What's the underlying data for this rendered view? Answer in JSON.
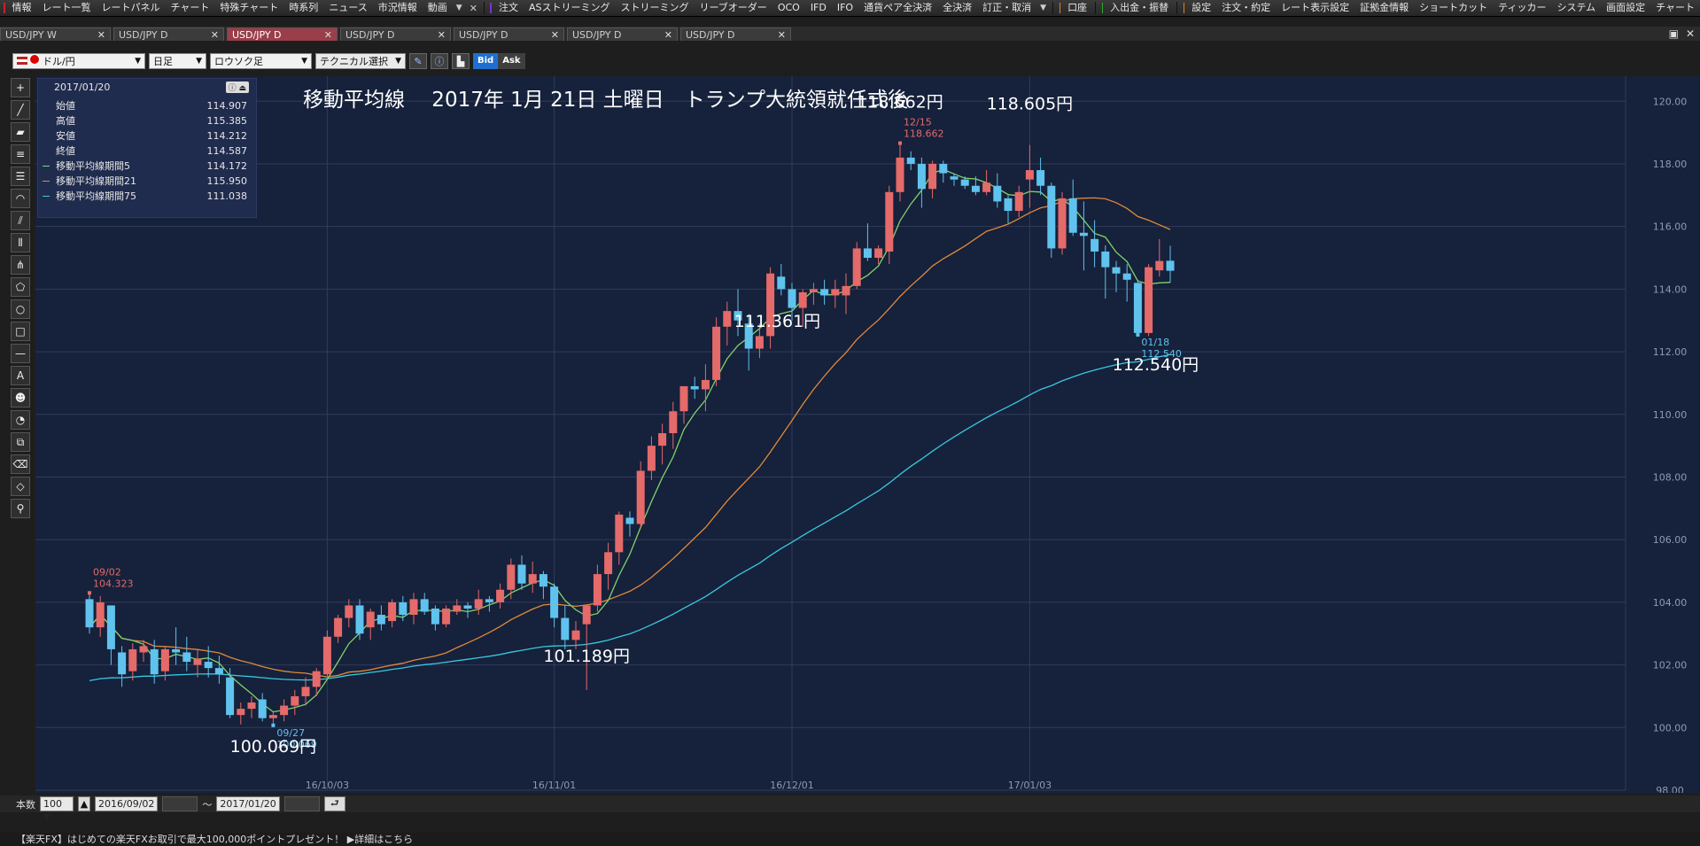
{
  "menubar": {
    "items": [
      {
        "label": "情報",
        "mark": "#cc2222"
      },
      {
        "label": "レート一覧"
      },
      {
        "label": "レートパネル"
      },
      {
        "label": "チャート"
      },
      {
        "label": "特殊チャート"
      },
      {
        "label": "時系列"
      },
      {
        "label": "ニュース"
      },
      {
        "label": "市況情報"
      },
      {
        "label": "動画"
      }
    ],
    "group2": [
      {
        "label": "注文",
        "mark": "#7733cc"
      },
      {
        "label": "ASストリーミング"
      },
      {
        "label": "ストリーミング"
      },
      {
        "label": "リーブオーダー"
      },
      {
        "label": "OCO"
      },
      {
        "label": "IFD"
      },
      {
        "label": "IFO"
      },
      {
        "label": "通貨ペア全決済"
      },
      {
        "label": "全決済"
      },
      {
        "label": "訂正・取消"
      }
    ],
    "group3": [
      {
        "label": "口座",
        "mark": "#e08020"
      }
    ],
    "group4": [
      {
        "label": "入出金・振替",
        "mark": "#33aa33"
      }
    ],
    "group5": [
      {
        "label": "設定",
        "mark": "#e08020"
      },
      {
        "label": "注文・約定"
      },
      {
        "label": "レート表示設定"
      },
      {
        "label": "証拠金情報"
      },
      {
        "label": "ショートカット"
      },
      {
        "label": "ティッカー"
      },
      {
        "label": "システム"
      },
      {
        "label": "画面設定"
      },
      {
        "label": "チャート"
      }
    ]
  },
  "tabs": [
    {
      "label": "USD/JPY W",
      "active": false
    },
    {
      "label": "USD/JPY D",
      "active": false
    },
    {
      "label": "USD/JPY D",
      "active": true
    },
    {
      "label": "USD/JPY D",
      "active": false
    },
    {
      "label": "USD/JPY D",
      "active": false
    },
    {
      "label": "USD/JPY D",
      "active": false
    },
    {
      "label": "USD/JPY D",
      "active": false
    }
  ],
  "toolbar": {
    "pair": "ドル/円",
    "timeframe": "日足",
    "chart_type": "ロウソク足",
    "technical": "テクニカル選択",
    "bid": "Bid",
    "ask": "Ask"
  },
  "databox": {
    "date": "2017/01/20",
    "rows": [
      {
        "label": "始値",
        "value": "114.907"
      },
      {
        "label": "高値",
        "value": "115.385"
      },
      {
        "label": "安値",
        "value": "114.212"
      },
      {
        "label": "終値",
        "value": "114.587"
      },
      {
        "label": "移動平均線期間5",
        "value": "114.172",
        "color": "#7fd36b"
      },
      {
        "label": "移動平均線期間21",
        "value": "115.950",
        "color": "#e0893b"
      },
      {
        "label": "移動平均線期間75",
        "value": "111.038",
        "color": "#38c8e0"
      }
    ]
  },
  "bottombar": {
    "count_label": "本数",
    "count_value": "100",
    "from_date": "2016/09/02",
    "tilde": "〜",
    "to_date": "2017/01/20"
  },
  "adbar": {
    "text": "【楽天FX】はじめての楽天FXお取引で最大100,000ポイントプレゼント！ ▶詳細はこちら"
  },
  "colors": {
    "up": "#e56a6a",
    "down": "#5fc3ee",
    "bg": "#16213b",
    "grid": "#2f3c5b"
  },
  "chart_data": {
    "type": "candlestick",
    "title": "移動平均線　 2017年 1月 21日 土曜日　トランプ大統領就任式後",
    "ylim": [
      98,
      120.8
    ],
    "yticks": [
      "98.00",
      "100.00",
      "102.00",
      "104.00",
      "106.00",
      "108.00",
      "110.00",
      "112.00",
      "114.00",
      "116.00",
      "118.00",
      "120.00"
    ],
    "x_labels": [
      {
        "label": "16/10/03",
        "index": 22
      },
      {
        "label": "16/11/01",
        "index": 43
      },
      {
        "label": "16/12/01",
        "index": 65
      },
      {
        "label": "17/01/03",
        "index": 87
      }
    ],
    "candles": [
      [
        104.1,
        104.3,
        103.0,
        103.2
      ],
      [
        103.2,
        104.2,
        102.9,
        104.0
      ],
      [
        103.9,
        103.9,
        102.0,
        102.5
      ],
      [
        102.4,
        102.6,
        101.3,
        101.7
      ],
      [
        101.8,
        102.7,
        101.5,
        102.5
      ],
      [
        102.4,
        102.8,
        102.1,
        102.6
      ],
      [
        102.5,
        102.8,
        101.4,
        101.7
      ],
      [
        101.8,
        102.6,
        101.5,
        102.5
      ],
      [
        102.5,
        103.2,
        102.0,
        102.4
      ],
      [
        102.4,
        102.9,
        101.8,
        102.1
      ],
      [
        102.0,
        102.5,
        101.6,
        102.2
      ],
      [
        102.1,
        102.6,
        101.6,
        101.9
      ],
      [
        101.9,
        102.3,
        101.4,
        101.7
      ],
      [
        101.6,
        101.9,
        100.3,
        100.4
      ],
      [
        100.4,
        100.8,
        100.1,
        100.6
      ],
      [
        100.6,
        101.0,
        100.3,
        100.8
      ],
      [
        100.9,
        101.1,
        100.2,
        100.3
      ],
      [
        100.3,
        100.5,
        100.07,
        100.4
      ],
      [
        100.4,
        100.9,
        100.2,
        100.7
      ],
      [
        100.7,
        101.2,
        100.4,
        101.0
      ],
      [
        101.0,
        101.6,
        100.7,
        101.3
      ],
      [
        101.3,
        101.9,
        101.0,
        101.8
      ],
      [
        101.7,
        103.1,
        101.6,
        102.9
      ],
      [
        102.9,
        103.6,
        102.7,
        103.5
      ],
      [
        103.5,
        104.1,
        103.2,
        103.9
      ],
      [
        103.9,
        104.1,
        102.8,
        103.0
      ],
      [
        103.2,
        103.8,
        102.8,
        103.7
      ],
      [
        103.6,
        103.9,
        103.1,
        103.3
      ],
      [
        103.4,
        104.1,
        103.2,
        104.0
      ],
      [
        104.0,
        104.2,
        103.4,
        103.6
      ],
      [
        103.6,
        104.3,
        103.3,
        104.1
      ],
      [
        104.1,
        104.3,
        103.6,
        103.7
      ],
      [
        103.8,
        103.9,
        103.1,
        103.3
      ],
      [
        103.3,
        103.9,
        103.2,
        103.8
      ],
      [
        103.7,
        104.1,
        103.6,
        103.9
      ],
      [
        103.9,
        104.0,
        103.5,
        103.8
      ],
      [
        103.8,
        104.4,
        103.6,
        104.1
      ],
      [
        104.1,
        104.2,
        103.7,
        104.0
      ],
      [
        104.0,
        104.6,
        103.8,
        104.4
      ],
      [
        104.4,
        105.4,
        104.1,
        105.2
      ],
      [
        105.2,
        105.5,
        104.4,
        104.6
      ],
      [
        104.6,
        105.3,
        104.3,
        104.9
      ],
      [
        104.9,
        105.0,
        104.1,
        104.5
      ],
      [
        104.5,
        104.6,
        103.2,
        103.5
      ],
      [
        103.5,
        103.9,
        102.5,
        102.8
      ],
      [
        102.8,
        103.4,
        102.5,
        103.1
      ],
      [
        103.3,
        103.9,
        101.2,
        103.9
      ],
      [
        103.9,
        105.2,
        103.7,
        104.9
      ],
      [
        104.9,
        105.9,
        104.4,
        105.6
      ],
      [
        105.6,
        106.9,
        105.2,
        106.8
      ],
      [
        106.7,
        106.9,
        106.1,
        106.5
      ],
      [
        106.5,
        108.5,
        106.4,
        108.2
      ],
      [
        108.2,
        109.3,
        107.9,
        109.0
      ],
      [
        109.0,
        109.7,
        108.4,
        109.4
      ],
      [
        109.4,
        110.4,
        108.9,
        110.1
      ],
      [
        110.1,
        110.9,
        109.7,
        110.9
      ],
      [
        110.9,
        111.2,
        110.5,
        110.8
      ],
      [
        110.8,
        111.6,
        110.1,
        111.1
      ],
      [
        111.1,
        113.1,
        110.9,
        112.8
      ],
      [
        112.8,
        113.6,
        112.2,
        113.3
      ],
      [
        113.3,
        114.0,
        112.5,
        113.0
      ],
      [
        112.9,
        113.2,
        111.4,
        112.1
      ],
      [
        112.1,
        112.9,
        111.8,
        112.5
      ],
      [
        112.5,
        114.7,
        112.1,
        114.5
      ],
      [
        114.4,
        114.8,
        113.8,
        114.0
      ],
      [
        114.0,
        114.2,
        113.0,
        113.4
      ],
      [
        113.4,
        114.0,
        112.8,
        113.9
      ],
      [
        113.9,
        114.2,
        113.5,
        114.0
      ],
      [
        114.0,
        114.3,
        113.5,
        113.8
      ],
      [
        113.8,
        114.3,
        113.4,
        114.0
      ],
      [
        113.8,
        114.5,
        113.2,
        114.1
      ],
      [
        114.1,
        115.5,
        114.0,
        115.3
      ],
      [
        115.3,
        116.1,
        114.9,
        115.0
      ],
      [
        115.0,
        115.4,
        114.8,
        115.3
      ],
      [
        115.2,
        117.3,
        114.8,
        117.1
      ],
      [
        117.1,
        118.662,
        116.8,
        118.2
      ],
      [
        118.2,
        118.4,
        117.8,
        118.0
      ],
      [
        118.0,
        118.2,
        116.6,
        117.2
      ],
      [
        117.2,
        118.1,
        116.9,
        118.0
      ],
      [
        118.0,
        118.1,
        117.4,
        117.7
      ],
      [
        117.6,
        117.7,
        117.3,
        117.5
      ],
      [
        117.5,
        117.6,
        117.2,
        117.3
      ],
      [
        117.3,
        117.6,
        117.0,
        117.1
      ],
      [
        117.1,
        117.8,
        117.0,
        117.4
      ],
      [
        117.3,
        117.7,
        116.6,
        116.8
      ],
      [
        116.9,
        117.0,
        116.1,
        116.5
      ],
      [
        116.5,
        117.3,
        116.3,
        117.1
      ],
      [
        117.5,
        118.605,
        116.6,
        117.8
      ],
      [
        117.8,
        118.2,
        117.0,
        117.3
      ],
      [
        117.3,
        117.4,
        115.0,
        115.3
      ],
      [
        115.3,
        117.1,
        115.1,
        116.9
      ],
      [
        116.9,
        117.5,
        115.7,
        115.8
      ],
      [
        115.8,
        116.8,
        114.6,
        115.7
      ],
      [
        115.6,
        116.2,
        114.7,
        115.2
      ],
      [
        115.2,
        115.4,
        113.7,
        114.7
      ],
      [
        114.7,
        114.9,
        113.9,
        114.5
      ],
      [
        114.5,
        114.8,
        113.6,
        114.3
      ],
      [
        114.2,
        114.3,
        112.54,
        112.6
      ],
      [
        112.6,
        114.8,
        112.5,
        114.7
      ],
      [
        114.6,
        115.6,
        114.4,
        114.9
      ],
      [
        114.907,
        115.385,
        114.212,
        114.587
      ]
    ],
    "annotations": [
      {
        "text": "118.662円",
        "index": 75
      },
      {
        "text": "118.605円",
        "index": 87
      },
      {
        "text": "111.361円",
        "index": 62
      },
      {
        "text": "112.540円",
        "index": 97
      },
      {
        "text": "101.189円",
        "index": 46
      },
      {
        "text": "100.069円",
        "index": 17
      }
    ],
    "markers": [
      {
        "date": "09/02",
        "value": "104.323",
        "index": 0,
        "kind": "high"
      },
      {
        "date": "09/27",
        "value": "100.069",
        "index": 17,
        "kind": "low"
      },
      {
        "date": "12/15",
        "value": "118.662",
        "index": 75,
        "kind": "high"
      },
      {
        "date": "01/18",
        "value": "112.540",
        "index": 97,
        "kind": "low"
      }
    ]
  }
}
